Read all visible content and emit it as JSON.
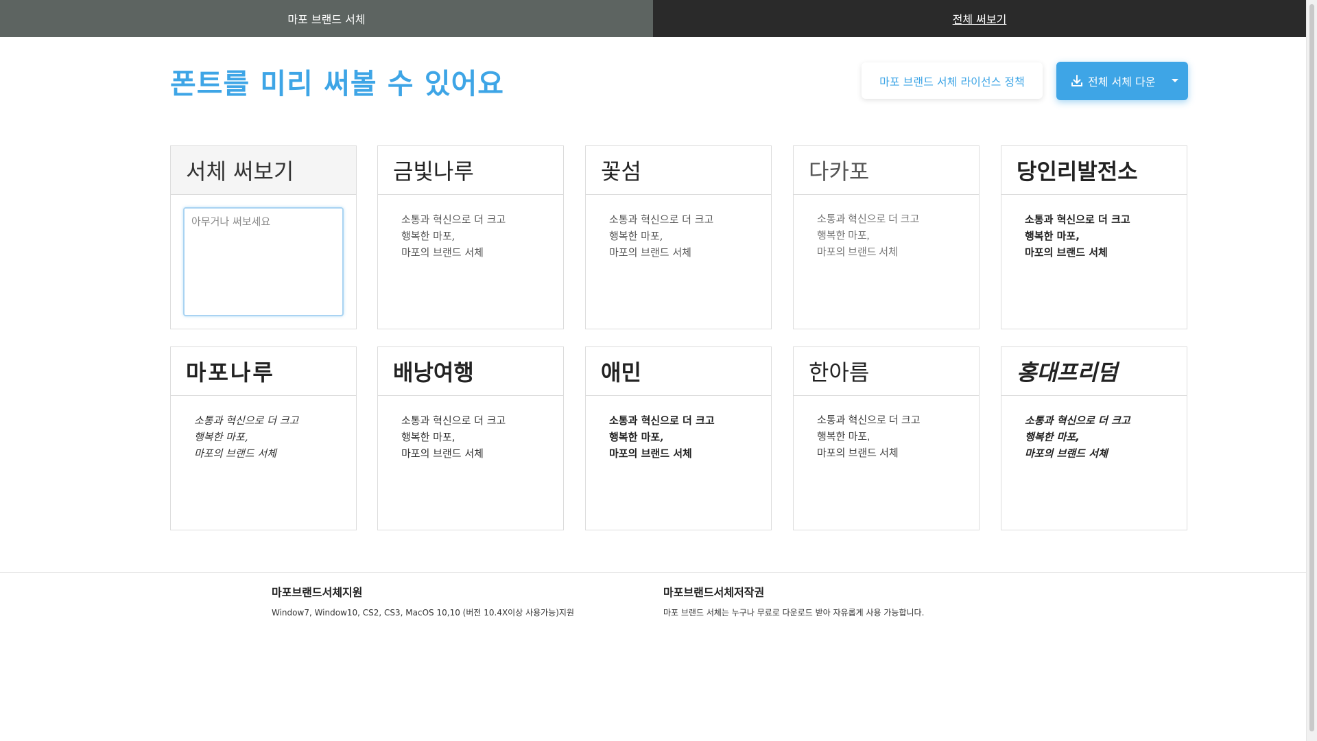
{
  "nav": {
    "tabs": [
      {
        "label": "마포 브랜드 서체"
      },
      {
        "label": "전체 써보기"
      }
    ]
  },
  "header": {
    "title": "폰트를 미리 써볼 수 있어요",
    "license_button": "마포 브랜드 서체 라이선스 정책",
    "download_button": "전체 서체 다운"
  },
  "preview": {
    "title": "서체 써보기",
    "placeholder": "아무거나 써보세요"
  },
  "fonts": [
    {
      "name": "금빛나루",
      "sample": [
        "소통과 혁신으로 더 크고",
        "행복한 마포,",
        "마포의 브랜드 서체"
      ]
    },
    {
      "name": "꽃섬",
      "sample": [
        "소통과 혁신으로 더 크고",
        "행복한 마포,",
        "마포의 브랜드 서체"
      ]
    },
    {
      "name": "다카포",
      "sample": [
        "소통과 혁신으로 더 크고",
        "행복한 마포,",
        "마포의 브랜드 서체"
      ]
    },
    {
      "name": "당인리발전소",
      "sample": [
        "소통과 혁신으로 더 크고",
        "행복한 마포,",
        "마포의 브랜드 서체"
      ]
    },
    {
      "name": "마포나루",
      "sample": [
        "소통과 혁신으로 더 크고",
        "행복한 마포,",
        "마포의 브랜드 서체"
      ]
    },
    {
      "name": "배낭여행",
      "sample": [
        "소통과 혁신으로 더 크고",
        "행복한 마포,",
        "마포의 브랜드 서체"
      ]
    },
    {
      "name": "애민",
      "sample": [
        "소통과 혁신으로 더 크고",
        "행복한 마포,",
        "마포의 브랜드 서체"
      ]
    },
    {
      "name": "한아름",
      "sample": [
        "소통과 혁신으로 더 크고",
        "행복한 마포,",
        "마포의 브랜드 서체"
      ]
    },
    {
      "name": "홍대프리덤",
      "sample": [
        "소통과 혁신으로 더 크고",
        "행복한 마포,",
        "마포의 브랜드 서체"
      ]
    }
  ],
  "footer": {
    "support_title": "마포브랜드서체지원",
    "support_text": "Window7, Window10, CS2, CS3, MacOS 10,10 (버전 10.4X이상 사용가능)지원",
    "copyright_title": "마포브랜드서체저작권",
    "copyright_text": "마포 브랜드 서체는 누구나 무료로 다운로드 받아 자유롭게 사용 가능합니다."
  },
  "colors": {
    "accent": "#3ea5e6",
    "nav_active": "#5d6461",
    "nav_inactive": "#2a2a2a"
  }
}
